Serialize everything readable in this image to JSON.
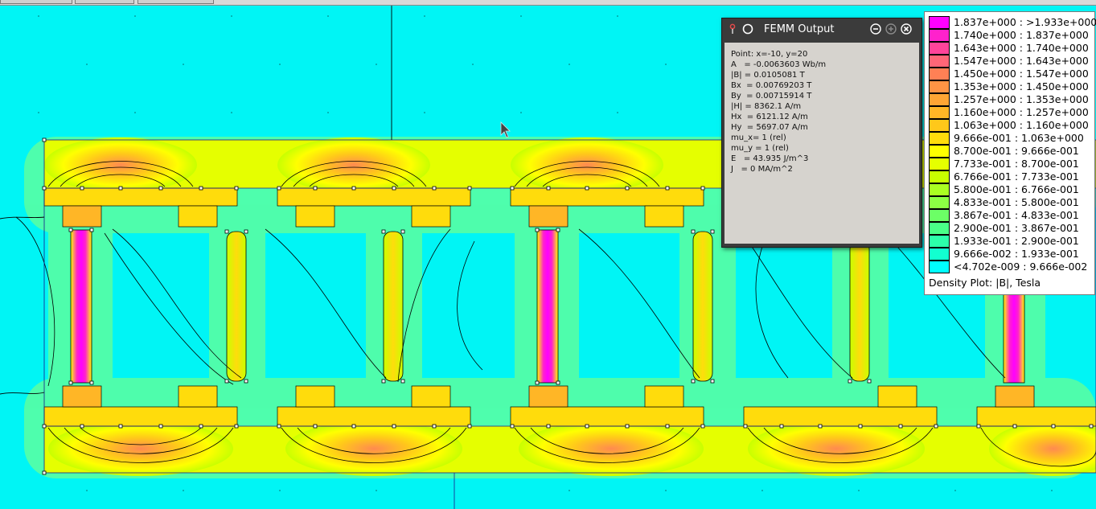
{
  "window": {
    "title": "FEMM Output",
    "icons": [
      "pin-icon",
      "circle-icon",
      "minimize-icon",
      "maximize-icon",
      "close-icon"
    ]
  },
  "output": {
    "lines": [
      "Point: x=-10, y=20",
      "A   = -0.0063603 Wb/m",
      "|B| = 0.0105081 T",
      "Bx  = 0.00769203 T",
      "By  = 0.00715914 T",
      "|H| = 8362.1 A/m",
      "Hx  = 6121.12 A/m",
      "Hy  = 5697.07 A/m",
      "mu_x= 1 (rel)",
      "mu_y = 1 (rel)",
      "E   = 43.935 J/m^3",
      "J   = 0 MA/m^2"
    ]
  },
  "legend": {
    "caption": "Density Plot: |B|, Tesla",
    "entries": [
      {
        "label": "1.837e+000 : >1.933e+000",
        "color": "#ff00ff"
      },
      {
        "label": "1.740e+000 : 1.837e+000",
        "color": "#ff22cc"
      },
      {
        "label": "1.643e+000 : 1.740e+000",
        "color": "#ff449a"
      },
      {
        "label": "1.547e+000 : 1.643e+000",
        "color": "#ff6677"
      },
      {
        "label": "1.450e+000 : 1.547e+000",
        "color": "#ff8055"
      },
      {
        "label": "1.353e+000 : 1.450e+000",
        "color": "#ff9444"
      },
      {
        "label": "1.257e+000 : 1.353e+000",
        "color": "#ffa534"
      },
      {
        "label": "1.160e+000 : 1.257e+000",
        "color": "#ffb626"
      },
      {
        "label": "1.063e+000 : 1.160e+000",
        "color": "#ffc81a"
      },
      {
        "label": "9.666e-001 : 1.063e+000",
        "color": "#ffdc0c"
      },
      {
        "label": "8.700e-001 : 9.666e-001",
        "color": "#ffff00"
      },
      {
        "label": "7.733e-001 : 8.700e-001",
        "color": "#e5ff00"
      },
      {
        "label": "6.766e-001 : 7.733e-001",
        "color": "#c8ff00"
      },
      {
        "label": "5.800e-001 : 6.766e-001",
        "color": "#aaff22"
      },
      {
        "label": "4.833e-001 : 5.800e-001",
        "color": "#8cff44"
      },
      {
        "label": "3.867e-001 : 4.833e-001",
        "color": "#6cff66"
      },
      {
        "label": "2.900e-001 : 3.867e-001",
        "color": "#4aff88"
      },
      {
        "label": "1.933e-001 : 2.900e-001",
        "color": "#2cffaa"
      },
      {
        "label": "9.666e-002 : 1.933e-001",
        "color": "#12ffd0"
      },
      {
        "label": "<4.702e-009 : 9.666e-002",
        "color": "#00ffff"
      }
    ]
  }
}
